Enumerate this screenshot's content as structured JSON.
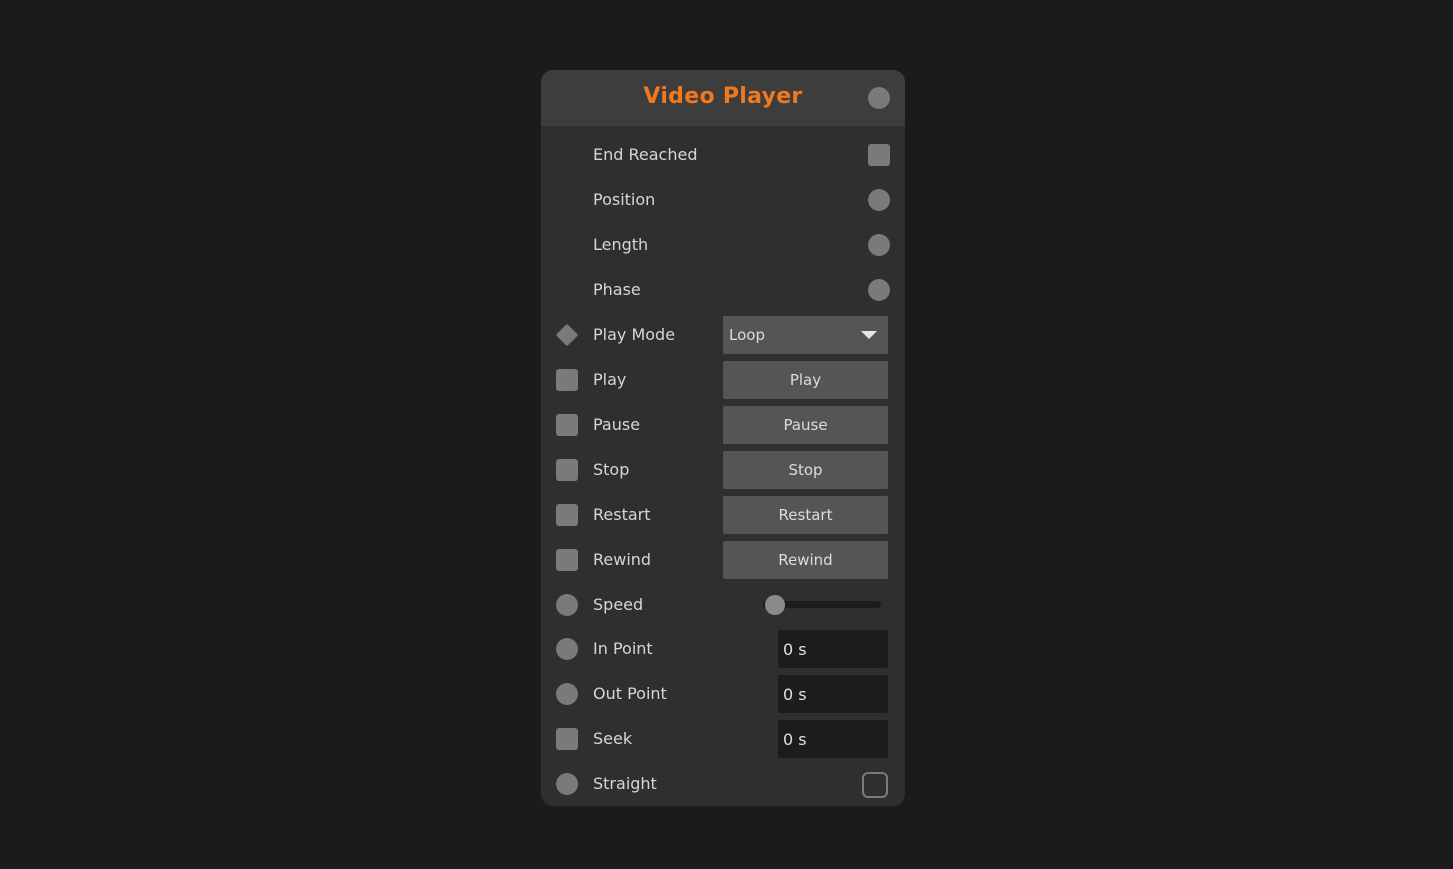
{
  "node": {
    "title": "Video Player",
    "colors": {
      "title": "#f0781e",
      "body": "#2f2f2f",
      "header": "#3d3d3d",
      "port": "#7a7a7a",
      "button": "#555555",
      "field": "#1c1c1c"
    }
  },
  "outputs": [
    {
      "label": "End Reached",
      "port": "square"
    },
    {
      "label": "Position",
      "port": "circle"
    },
    {
      "label": "Length",
      "port": "circle"
    },
    {
      "label": "Phase",
      "port": "circle"
    }
  ],
  "inputs": {
    "play_mode": {
      "label": "Play Mode",
      "port": "diamond",
      "selected": "Loop"
    },
    "play": {
      "label": "Play",
      "port": "square",
      "button": "Play"
    },
    "pause": {
      "label": "Pause",
      "port": "square",
      "button": "Pause"
    },
    "stop": {
      "label": "Stop",
      "port": "square",
      "button": "Stop"
    },
    "restart": {
      "label": "Restart",
      "port": "square",
      "button": "Restart"
    },
    "rewind": {
      "label": "Rewind",
      "port": "square",
      "button": "Rewind"
    },
    "speed": {
      "label": "Speed",
      "port": "circle",
      "value_fraction": 0.1
    },
    "in_point": {
      "label": "In Point",
      "port": "circle",
      "value": "0 s"
    },
    "out_point": {
      "label": "Out Point",
      "port": "circle",
      "value": "0 s"
    },
    "seek": {
      "label": "Seek",
      "port": "square",
      "value": "0 s"
    },
    "straight": {
      "label": "Straight",
      "port": "circle",
      "checked": false
    }
  }
}
